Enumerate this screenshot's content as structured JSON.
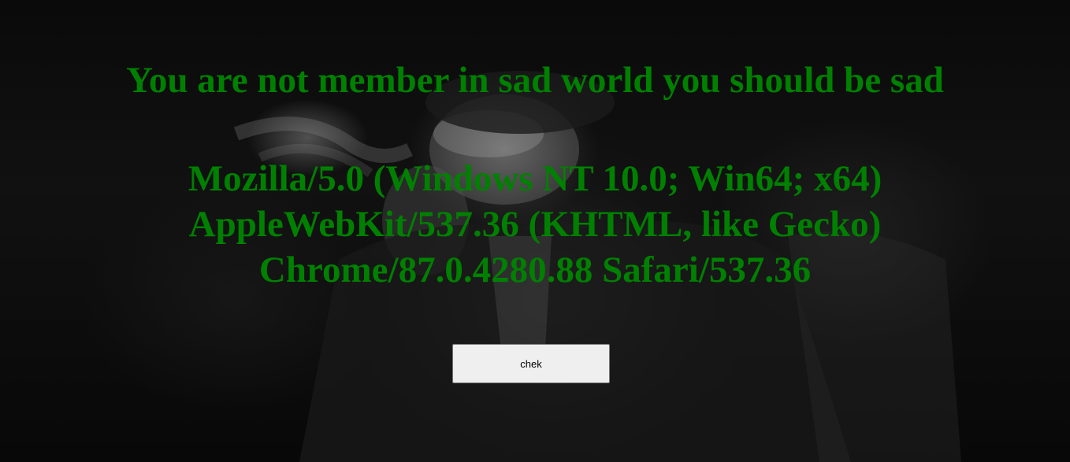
{
  "main": {
    "headline": "You are not member in sad world you should be sad",
    "user_agent": "Mozilla/5.0 (Windows NT 10.0; Win64; x64) AppleWebKit/537.36 (KHTML, like Gecko) Chrome/87.0.4280.88 Safari/537.36",
    "button_label": "chek"
  },
  "colors": {
    "text": "#008000",
    "background": "#000000",
    "button_bg": "#efefef"
  }
}
